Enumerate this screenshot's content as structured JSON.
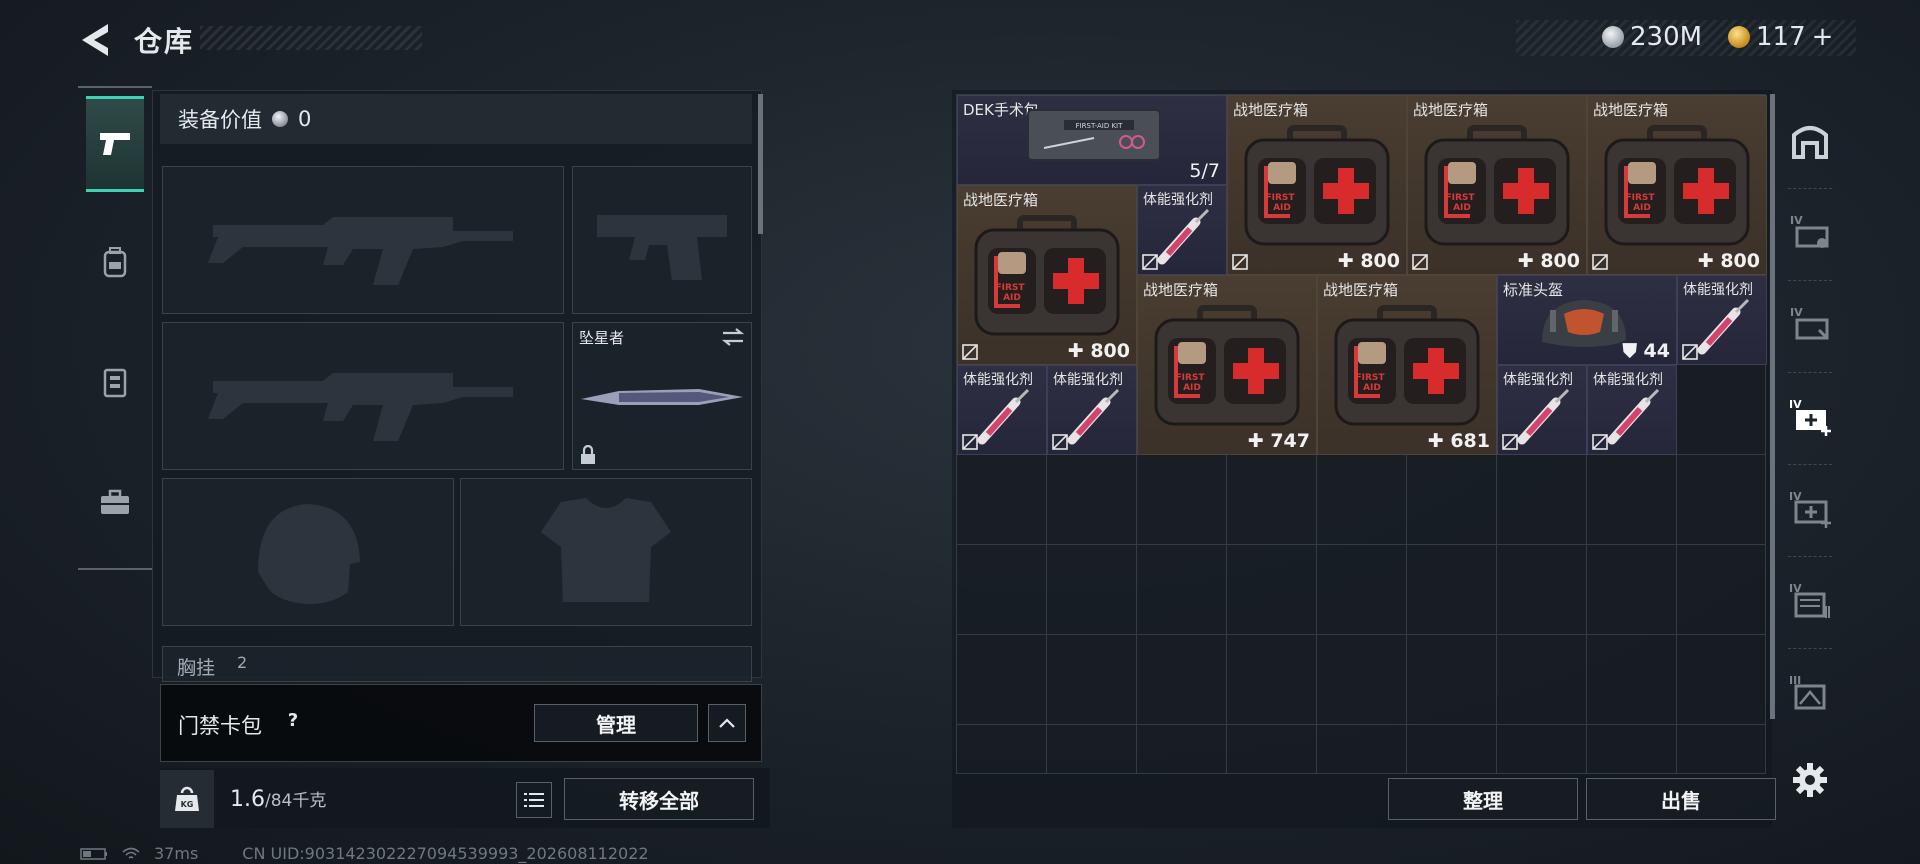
{
  "header": {
    "title": "仓库"
  },
  "currency": [
    {
      "amount": "230M",
      "icon": "silver-coin-icon",
      "color": "#c9ccd0"
    },
    {
      "amount": "117",
      "suffix": "+",
      "icon": "gold-coin-icon",
      "color": "#d9a936"
    }
  ],
  "side_tabs": [
    {
      "icon": "pistol-icon",
      "active": true
    },
    {
      "icon": "backpack-icon",
      "active": false
    },
    {
      "icon": "vest-icon",
      "active": false
    },
    {
      "icon": "toolbox-icon",
      "active": false
    }
  ],
  "equipment": {
    "value_label": "装备价值",
    "value": "0",
    "melee_name": "坠星者",
    "partial_label": "胸挂",
    "partial_count": "2"
  },
  "keycard": {
    "label": "门禁卡包",
    "help": "?",
    "manage_label": "管理"
  },
  "weight": {
    "current": "1.6",
    "max_unit": "/84千克",
    "icon_label": "KG"
  },
  "transfer_all_label": "转移全部",
  "status": {
    "ping": "37ms",
    "uid": "CN UID:903142302227094539993_202608112022"
  },
  "inventory": {
    "items": [
      {
        "name": "DEK手术包",
        "value": "5/7",
        "rarity": "purple",
        "icon": "surgery-kit-icon"
      },
      {
        "name": "战地医疗箱",
        "value": "800",
        "rarity": "brown",
        "icon": "first-aid-box-icon"
      },
      {
        "name": "战地医疗箱",
        "value": "800",
        "rarity": "brown",
        "icon": "first-aid-box-icon"
      },
      {
        "name": "战地医疗箱",
        "value": "800",
        "rarity": "brown",
        "icon": "first-aid-box-icon"
      },
      {
        "name": "战地医疗箱",
        "value": "800",
        "rarity": "brown",
        "icon": "first-aid-box-icon"
      },
      {
        "name": "体能强化剂",
        "value": "",
        "rarity": "purple",
        "icon": "syringe-icon"
      },
      {
        "name": "战地医疗箱",
        "value": "747",
        "rarity": "brown",
        "icon": "first-aid-box-icon"
      },
      {
        "name": "战地医疗箱",
        "value": "681",
        "rarity": "brown",
        "icon": "first-aid-box-icon"
      },
      {
        "name": "标准头盔",
        "value": "44",
        "rarity": "purple",
        "icon": "helmet-icon"
      },
      {
        "name": "体能强化剂",
        "value": "",
        "rarity": "purple",
        "icon": "syringe-icon"
      },
      {
        "name": "体能强化剂",
        "value": "",
        "rarity": "purple",
        "icon": "syringe-icon"
      },
      {
        "name": "体能强化剂",
        "value": "",
        "rarity": "purple",
        "icon": "syringe-icon"
      },
      {
        "name": "体能强化剂",
        "value": "",
        "rarity": "purple",
        "icon": "syringe-icon"
      },
      {
        "name": "体能强化剂",
        "value": "",
        "rarity": "purple",
        "icon": "syringe-icon"
      }
    ],
    "first_aid_label": "FIRST AID",
    "kit_label": "FIRST-AID KIT"
  },
  "actions": {
    "sort_label": "整理",
    "sell_label": "出售"
  },
  "categories": [
    {
      "icon": "armory-icon"
    },
    {
      "icon": "category-iv-1-icon",
      "badge": "IV"
    },
    {
      "icon": "category-iv-2-icon",
      "badge": "IV"
    },
    {
      "icon": "medical-iv-icon",
      "badge": "IV",
      "active": true
    },
    {
      "icon": "medical-iv-2-icon",
      "badge": "IV"
    },
    {
      "icon": "category-iv-3-icon",
      "badge": "IV"
    },
    {
      "icon": "category-iii-icon",
      "badge": "III"
    },
    {
      "icon": "settings-gear-icon"
    }
  ]
}
